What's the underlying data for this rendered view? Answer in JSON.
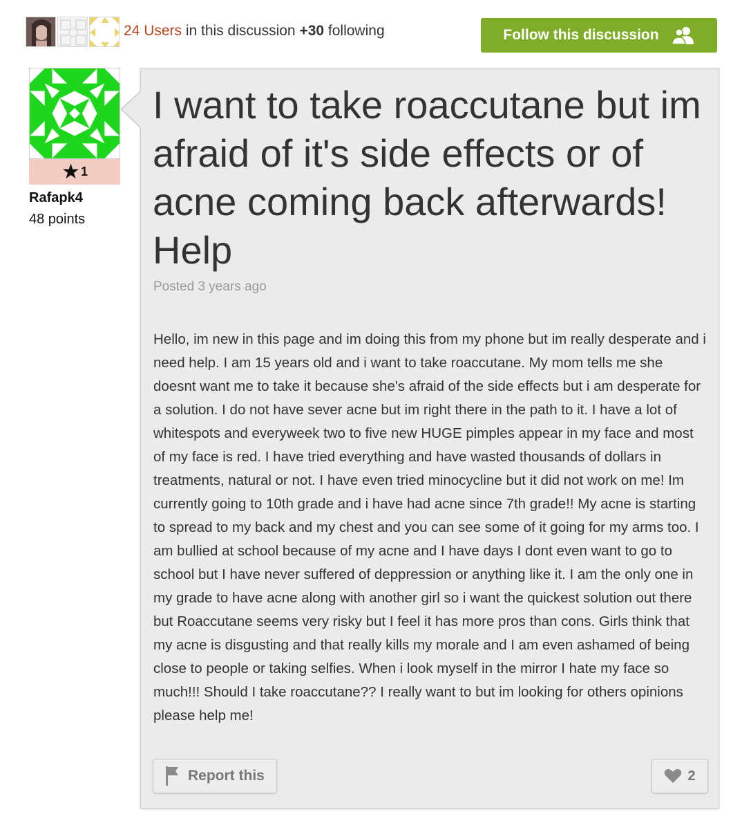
{
  "header": {
    "users_count": "24 Users",
    "users_text": " in this discussion ",
    "following_count": "+30",
    "following_text": " following",
    "follow_button": "Follow this discussion"
  },
  "author": {
    "badge_count": "1",
    "name": "Rafapk4",
    "points": "48 points"
  },
  "post": {
    "title": "I want to take roaccutane but im afraid of it's side effects or of acne coming back afterwards! Help",
    "meta": "Posted 3 years ago",
    "body": "Hello, im new in this page and im doing this from my phone but im really desperate and i need help. I am 15 years old and i want to take roaccutane. My mom tells me she doesnt want me to take it because she's afraid of the side effects but i am desperate for a solution. I do not have sever acne but im right there in the path to it. I have a lot of whitespots and everyweek two to five new HUGE pimples appear in my face and most of my face is red. I have tried everything and have wasted thousands of dollars in treatments, natural or not. I have even tried minocycline but it did not work on me! Im currently going to 10th grade and i have had acne since 7th grade!! My acne is starting to spread to my back and my chest and you can see some of it going for my arms too. I am bullied at school because of my acne and I have days I dont even want to go to school but I have never suffered of deppression or anything like it. I am the only one in my grade to have acne along with another girl so i want the quickest solution out there but Roaccutane seems very risky but I feel it has more pros than cons. Girls think that my acne is disgusting and that really kills my morale and I am even ashamed of being close to people or taking selfies. When i look myself in the mirror I hate my face so much!!!  Should I take roaccutane?? I really want to but im looking for others opinions please help me!",
    "report_label": "Report this",
    "like_count": "2"
  },
  "colors": {
    "accent_green": "#7fad2a",
    "link_orange": "#b8451d",
    "badge_pink": "#f3cdc4",
    "identicon_green": "#1fd61f"
  },
  "icons": [
    "people-icon",
    "star-icon",
    "flag-icon",
    "heart-icon"
  ]
}
